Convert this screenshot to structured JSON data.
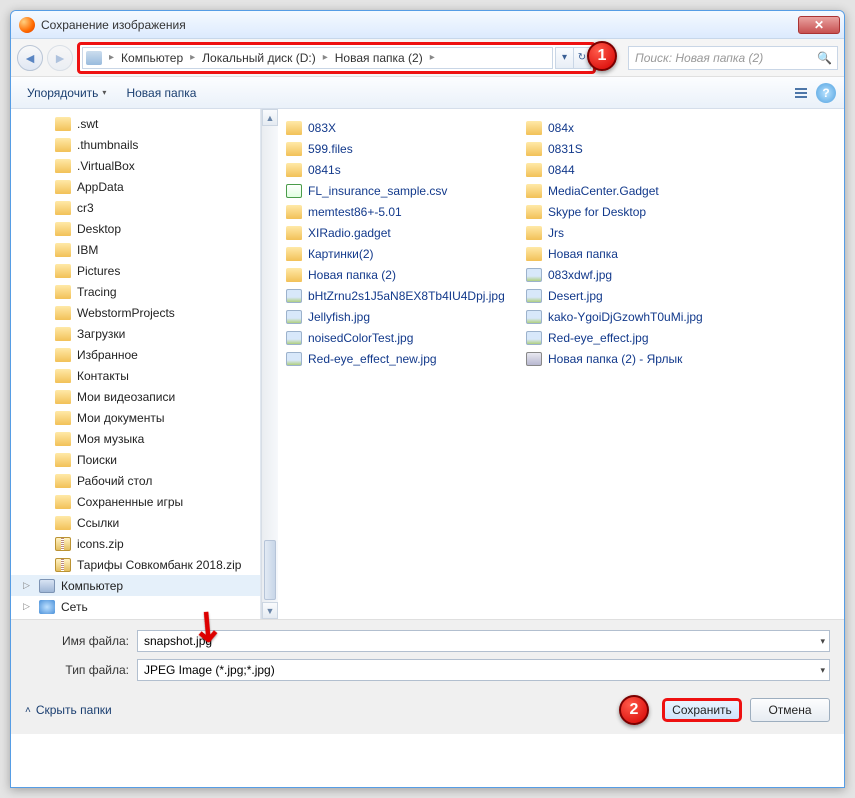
{
  "title": "Сохранение изображения",
  "close_x": "✕",
  "nav": {
    "back": "◄",
    "fwd": "►"
  },
  "breadcrumb": {
    "sep": "▸",
    "items": [
      "Компьютер",
      "Локальный диск (D:)",
      "Новая папка (2)"
    ]
  },
  "addr_btns": {
    "drop": "▾",
    "refresh": "↻"
  },
  "search": {
    "placeholder": "Поиск: Новая папка (2)",
    "icon": "🔍"
  },
  "markers": {
    "one": "1",
    "two": "2"
  },
  "toolbar": {
    "organize": "Упорядочить",
    "newfolder": "Новая папка",
    "drop": "▾",
    "help": "?"
  },
  "tree": [
    {
      "label": ".swt",
      "icon": "folder-i",
      "depth": 1
    },
    {
      "label": ".thumbnails",
      "icon": "folder-i",
      "depth": 1
    },
    {
      "label": ".VirtualBox",
      "icon": "folder-i",
      "depth": 1
    },
    {
      "label": "AppData",
      "icon": "folder-i",
      "depth": 1
    },
    {
      "label": "cr3",
      "icon": "folder-i",
      "depth": 1
    },
    {
      "label": "Desktop",
      "icon": "folder-i",
      "depth": 1
    },
    {
      "label": "IBM",
      "icon": "folder-i",
      "depth": 1
    },
    {
      "label": "Pictures",
      "icon": "folder-i",
      "depth": 1
    },
    {
      "label": "Tracing",
      "icon": "folder-i",
      "depth": 1
    },
    {
      "label": "WebstormProjects",
      "icon": "folder-i",
      "depth": 1
    },
    {
      "label": "Загрузки",
      "icon": "folder-i",
      "depth": 1
    },
    {
      "label": "Избранное",
      "icon": "folder-i",
      "depth": 1
    },
    {
      "label": "Контакты",
      "icon": "folder-i",
      "depth": 1
    },
    {
      "label": "Мои видеозаписи",
      "icon": "folder-i",
      "depth": 1
    },
    {
      "label": "Мои документы",
      "icon": "folder-i",
      "depth": 1
    },
    {
      "label": "Моя музыка",
      "icon": "folder-i",
      "depth": 1
    },
    {
      "label": "Поиски",
      "icon": "folder-i",
      "depth": 1
    },
    {
      "label": "Рабочий стол",
      "icon": "folder-i",
      "depth": 1
    },
    {
      "label": "Сохраненные игры",
      "icon": "folder-i",
      "depth": 1
    },
    {
      "label": "Ссылки",
      "icon": "folder-i",
      "depth": 1
    },
    {
      "label": "icons.zip",
      "icon": "zip-i",
      "depth": 1
    },
    {
      "label": "Тарифы Совкомбанк 2018.zip",
      "icon": "zip-i",
      "depth": 1
    },
    {
      "label": "Компьютер",
      "icon": "comp-i",
      "depth": 0,
      "tri": "▷",
      "hl": true
    },
    {
      "label": "Сеть",
      "icon": "net-i",
      "depth": 0,
      "tri": "▷"
    }
  ],
  "files_col1": [
    {
      "label": "083X",
      "icon": "folder-i"
    },
    {
      "label": "599.files",
      "icon": "folder-i"
    },
    {
      "label": "0841s",
      "icon": "folder-i"
    },
    {
      "label": "FL_insurance_sample.csv",
      "icon": "csv-i"
    },
    {
      "label": "memtest86+-5.01",
      "icon": "folder-i"
    },
    {
      "label": "XIRadio.gadget",
      "icon": "folder-i"
    },
    {
      "label": "Картинки(2)",
      "icon": "folder-i"
    },
    {
      "label": "Новая папка (2)",
      "icon": "folder-i"
    },
    {
      "label": "bHtZrnu2s1J5aN8EX8Tb4IU4Dpj.jpg",
      "icon": "img-i"
    },
    {
      "label": "Jellyfish.jpg",
      "icon": "img-i"
    },
    {
      "label": "noisedColorTest.jpg",
      "icon": "img-i"
    },
    {
      "label": "Red-eye_effect_new.jpg",
      "icon": "img-i"
    }
  ],
  "files_col2": [
    {
      "label": "084x",
      "icon": "folder-i"
    },
    {
      "label": "0831S",
      "icon": "folder-i"
    },
    {
      "label": "0844",
      "icon": "folder-i"
    },
    {
      "label": "MediaCenter.Gadget",
      "icon": "folder-i"
    },
    {
      "label": "Skype for Desktop",
      "icon": "folder-i"
    },
    {
      "label": "Jrs",
      "icon": "folder-i"
    },
    {
      "label": "Новая папка",
      "icon": "folder-i"
    },
    {
      "label": "083xdwf.jpg",
      "icon": "img-i"
    },
    {
      "label": "Desert.jpg",
      "icon": "img-i"
    },
    {
      "label": "kako-YgoiDjGzowhT0uMi.jpg",
      "icon": "img-i"
    },
    {
      "label": "Red-eye_effect.jpg",
      "icon": "img-i"
    },
    {
      "label": "Новая папка (2) - Ярлык",
      "icon": "gadget-i"
    }
  ],
  "form": {
    "filename_label": "Имя файла:",
    "filename_value": "snapshot.jpg",
    "filetype_label": "Тип файла:",
    "filetype_value": "JPEG Image (*.jpg;*.jpg)",
    "drop": "▾"
  },
  "footer": {
    "hide": "Скрыть папки",
    "chev": "˄",
    "save": "Сохранить",
    "cancel": "Отмена"
  },
  "arrow": "↘"
}
